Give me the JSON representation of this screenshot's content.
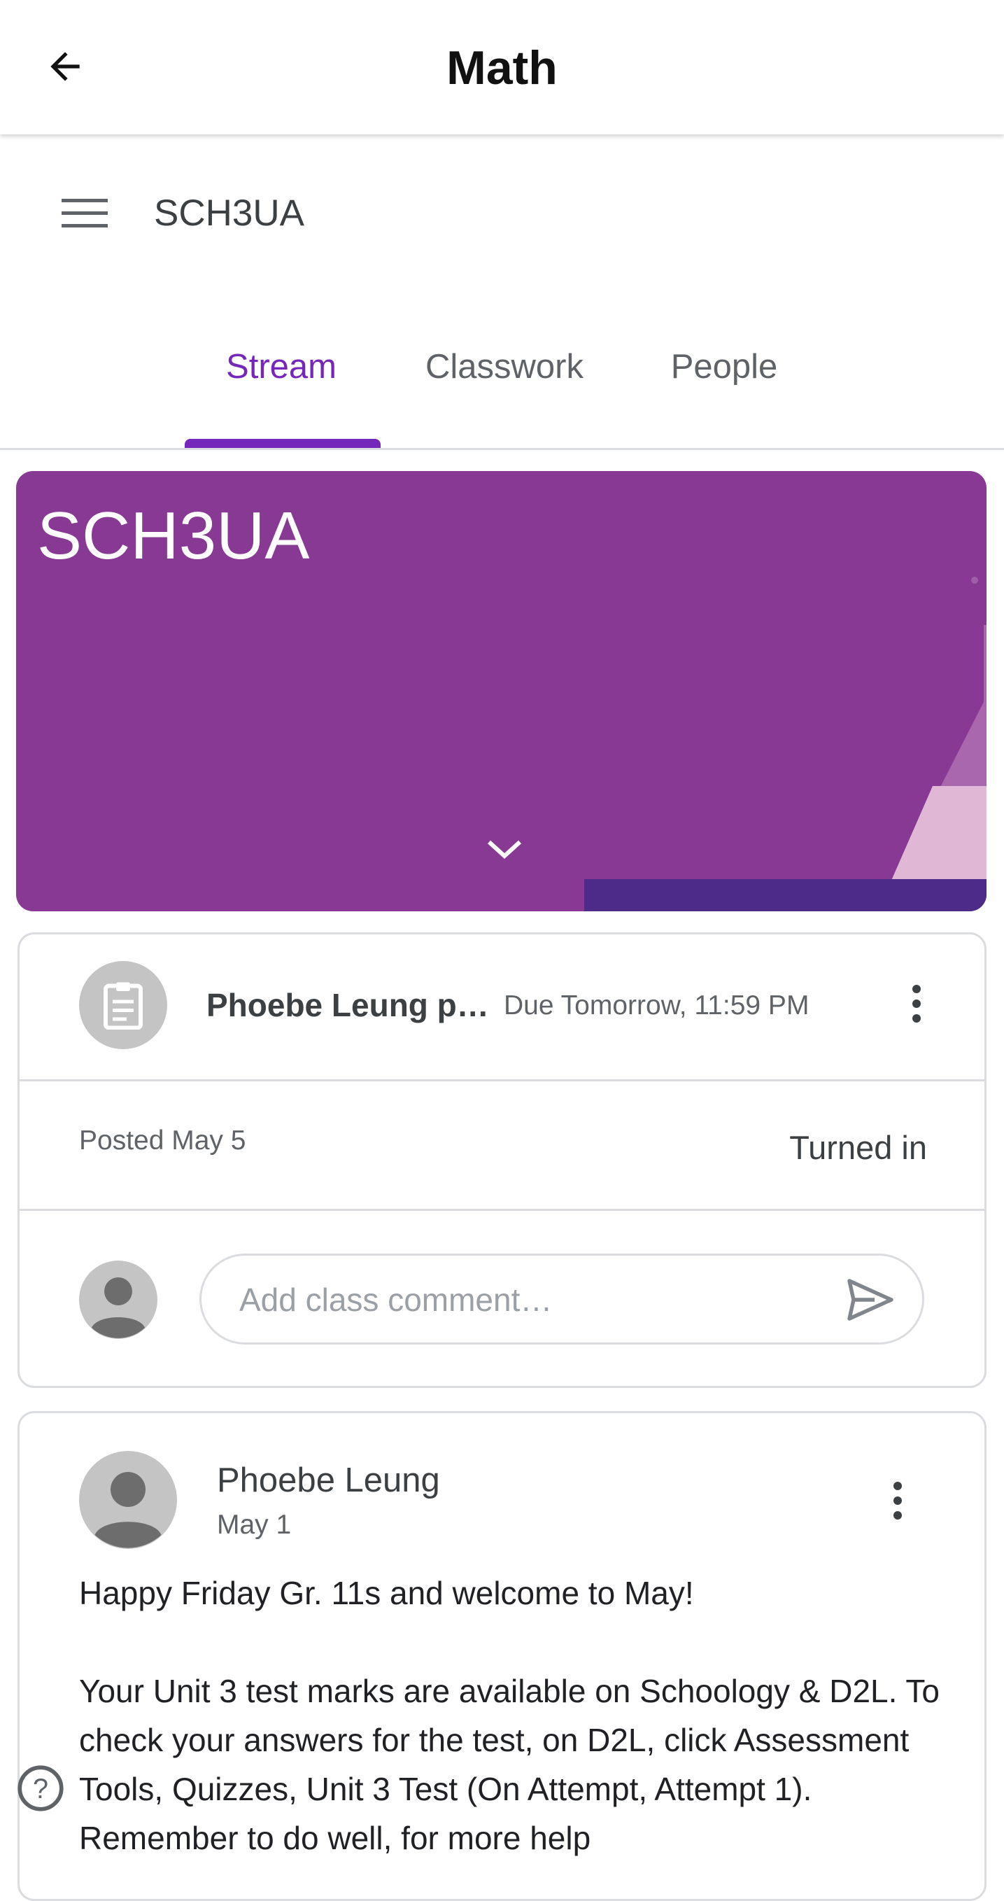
{
  "header": {
    "title": "Math"
  },
  "class_bar": {
    "name": "SCH3UA"
  },
  "tabs": [
    {
      "label": "Stream",
      "active": true
    },
    {
      "label": "Classwork"
    },
    {
      "label": "People"
    }
  ],
  "banner": {
    "title": "SCH3UA",
    "color": "#873993",
    "strip_color": "#4c2b89"
  },
  "assignment": {
    "title": "Phoebe Leung p…",
    "due": "Due Tomorrow, 11:59 PM",
    "posted": "Posted May 5",
    "status": "Turned in",
    "comment_placeholder": "Add class comment…"
  },
  "announcement": {
    "author": "Phoebe Leung",
    "date": "May 1",
    "paragraphs": [
      "Happy Friday Gr. 11s and welcome to May!",
      "Your Unit 3 test marks are available on Schoology & D2L. To check your answers for the test, on D2L, click Assessment Tools, Quizzes, Unit 3 Test (On Attempt, Attempt 1). Remember to do well, for more help"
    ]
  },
  "accent": "#7627bb"
}
